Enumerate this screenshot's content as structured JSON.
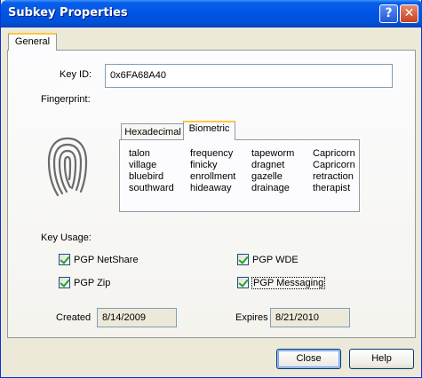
{
  "window": {
    "title": "Subkey Properties",
    "help_glyph": "?",
    "close_glyph": "✕"
  },
  "tabs": [
    {
      "label": "General",
      "selected": true
    }
  ],
  "general": {
    "key_id_label": "Key ID:",
    "key_id_value": "0x6FA68A40",
    "fingerprint_label": "Fingerprint:",
    "fingerprint_tabs": [
      {
        "label": "Hexadecimal",
        "selected": false
      },
      {
        "label": "Biometric",
        "selected": true
      }
    ],
    "biometric_words": [
      [
        "talon",
        "frequency",
        "tapeworm",
        "Capricorn"
      ],
      [
        "village",
        "finicky",
        "dragnet",
        "Capricorn"
      ],
      [
        "bluebird",
        "enrollment",
        "gazelle",
        "retraction"
      ],
      [
        "southward",
        "hideaway",
        "drainage",
        "therapist"
      ]
    ],
    "key_usage_label": "Key Usage:",
    "usage": {
      "netshare": {
        "label": "PGP NetShare",
        "checked": true
      },
      "wde": {
        "label": "PGP WDE",
        "checked": true
      },
      "zip": {
        "label": "PGP Zip",
        "checked": true
      },
      "messaging": {
        "label": "PGP Messaging",
        "checked": true
      }
    },
    "created_label": "Created",
    "created_value": "8/14/2009",
    "expires_label": "Expires",
    "expires_value": "8/21/2010"
  },
  "buttons": {
    "close": "Close",
    "help": "Help"
  },
  "icons": [
    "help-icon",
    "close-icon",
    "fingerprint-icon",
    "checkbox-icon"
  ],
  "colors": {
    "titlebar": "#0054e3",
    "dialog_bg": "#ece9d8",
    "tab_highlight": "#ffc83c",
    "check": "#21a121"
  }
}
